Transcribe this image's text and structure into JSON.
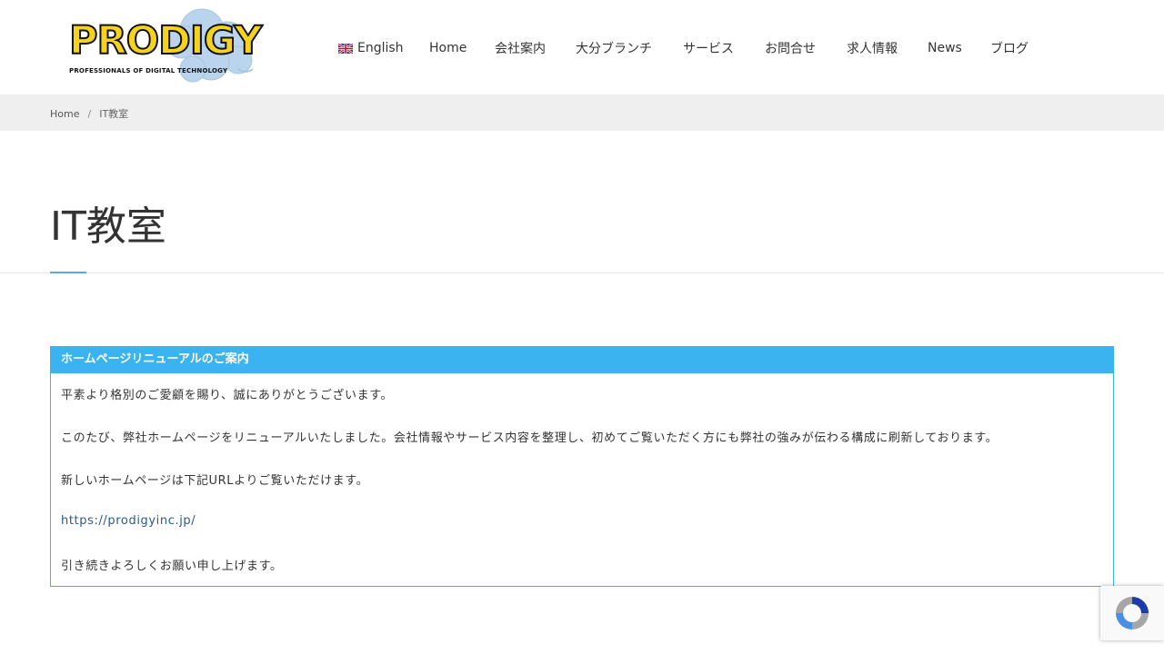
{
  "header": {
    "logo_text": "PRODIGY",
    "logo_tagline": "PROFESSIONALS OF DIGITAL TECHNOLOGY",
    "nav": [
      {
        "label": "English",
        "icon": "uk-flag-icon"
      },
      {
        "label": "Home"
      },
      {
        "label": "会社案内"
      },
      {
        "label": "大分ブランチ"
      },
      {
        "label": "サービス"
      },
      {
        "label": "お問合せ"
      },
      {
        "label": "求人情報"
      },
      {
        "label": "News"
      },
      {
        "label": "ブログ"
      }
    ]
  },
  "breadcrumb": {
    "home": "Home",
    "separator": "/",
    "current": "IT教室"
  },
  "page": {
    "title": "IT教室"
  },
  "notice": {
    "heading": "ホームページリニューアルのご案内",
    "lines": [
      "平素より格別のご愛顧を賜り、誠にありがとうございます。",
      "このたび、弊社ホームページをリニューアルいたしました。会社情報やサービス内容を整理し、初めてご覧いただく方にも弊社の強みが伝わる構成に刷新しております。",
      "新しいホームページは下記URLよりご覧いただけます。",
      "https://prodigyinc.jp/",
      "引き続きよろしくお願い申し上げます。"
    ]
  },
  "colors": {
    "accent": "#3bb3f0",
    "breadcrumb_bg": "#efefef",
    "link": "#2a5a8a",
    "logo_yellow": "#f5d21c"
  },
  "recaptcha": {
    "icon": "recaptcha-icon"
  }
}
